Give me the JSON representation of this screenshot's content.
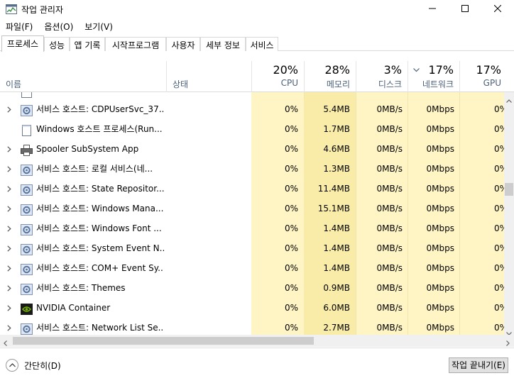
{
  "window": {
    "title": "작업 관리자"
  },
  "menu": [
    {
      "label": "파일(F)"
    },
    {
      "label": "옵션(O)"
    },
    {
      "label": "보기(V)"
    }
  ],
  "tabs": [
    {
      "label": "프로세스",
      "active": true
    },
    {
      "label": "성능"
    },
    {
      "label": "앱 기록"
    },
    {
      "label": "시작프로그램"
    },
    {
      "label": "사용자"
    },
    {
      "label": "세부 정보"
    },
    {
      "label": "서비스"
    }
  ],
  "columns": {
    "name": {
      "label": "이름"
    },
    "status": {
      "label": "상태"
    },
    "cpu": {
      "pct": "20%",
      "label": "CPU"
    },
    "memory": {
      "pct": "28%",
      "label": "메모리"
    },
    "disk": {
      "pct": "3%",
      "label": "디스크"
    },
    "network": {
      "pct": "17%",
      "label": "네트워크",
      "sorted": true
    },
    "gpu": {
      "pct": "17%",
      "label": "GPU"
    }
  },
  "rows": [
    {
      "expandable": true,
      "icon": "gear-icon",
      "name": "서비스 호스트: CDPUserSvc_37...",
      "cpu": "0%",
      "memory": "5.4MB",
      "disk": "0MB/s",
      "network": "0Mbps",
      "gpu": "0%"
    },
    {
      "expandable": false,
      "icon": "window-icon",
      "name": "Windows 호스트 프로세스(Run...",
      "cpu": "0%",
      "memory": "1.7MB",
      "disk": "0MB/s",
      "network": "0Mbps",
      "gpu": "0%"
    },
    {
      "expandable": true,
      "icon": "printer-icon",
      "name": "Spooler SubSystem App",
      "cpu": "0%",
      "memory": "4.6MB",
      "disk": "0MB/s",
      "network": "0Mbps",
      "gpu": "0%"
    },
    {
      "expandable": true,
      "icon": "gear-icon",
      "name": "서비스 호스트: 로컬 서비스(네...",
      "cpu": "0%",
      "memory": "1.3MB",
      "disk": "0MB/s",
      "network": "0Mbps",
      "gpu": "0%"
    },
    {
      "expandable": true,
      "icon": "gear-icon",
      "name": "서비스 호스트: State Repositor...",
      "cpu": "0%",
      "memory": "11.4MB",
      "disk": "0MB/s",
      "network": "0Mbps",
      "gpu": "0%"
    },
    {
      "expandable": true,
      "icon": "gear-icon",
      "name": "서비스 호스트: Windows Mana...",
      "cpu": "0%",
      "memory": "15.1MB",
      "disk": "0MB/s",
      "network": "0Mbps",
      "gpu": "0%"
    },
    {
      "expandable": true,
      "icon": "gear-icon",
      "name": "서비스 호스트: Windows Font ...",
      "cpu": "0%",
      "memory": "1.4MB",
      "disk": "0MB/s",
      "network": "0Mbps",
      "gpu": "0%"
    },
    {
      "expandable": true,
      "icon": "gear-icon",
      "name": "서비스 호스트: System Event N...",
      "cpu": "0%",
      "memory": "1.4MB",
      "disk": "0MB/s",
      "network": "0Mbps",
      "gpu": "0%"
    },
    {
      "expandable": true,
      "icon": "gear-icon",
      "name": "서비스 호스트: COM+ Event Sy...",
      "cpu": "0%",
      "memory": "1.4MB",
      "disk": "0MB/s",
      "network": "0Mbps",
      "gpu": "0%"
    },
    {
      "expandable": true,
      "icon": "gear-icon",
      "name": "서비스 호스트: Themes",
      "cpu": "0%",
      "memory": "0.9MB",
      "disk": "0MB/s",
      "network": "0Mbps",
      "gpu": "0%"
    },
    {
      "expandable": true,
      "icon": "nvidia-icon",
      "name": "NVIDIA Container",
      "cpu": "0%",
      "memory": "6.0MB",
      "disk": "0MB/s",
      "network": "0Mbps",
      "gpu": "0%"
    },
    {
      "expandable": true,
      "icon": "gear-icon",
      "name": "서비스 호스트: Network List Se...",
      "cpu": "0%",
      "memory": "2.7MB",
      "disk": "0MB/s",
      "network": "0Mbps",
      "gpu": "0%"
    }
  ],
  "footer": {
    "collapse_label": "간단히(D)",
    "end_task_label": "작업 끝내기(E)"
  },
  "colors": {
    "cell_bg": "#fff4c4",
    "memory_bg": "#f9eca8",
    "header_label": "#4c607a"
  }
}
